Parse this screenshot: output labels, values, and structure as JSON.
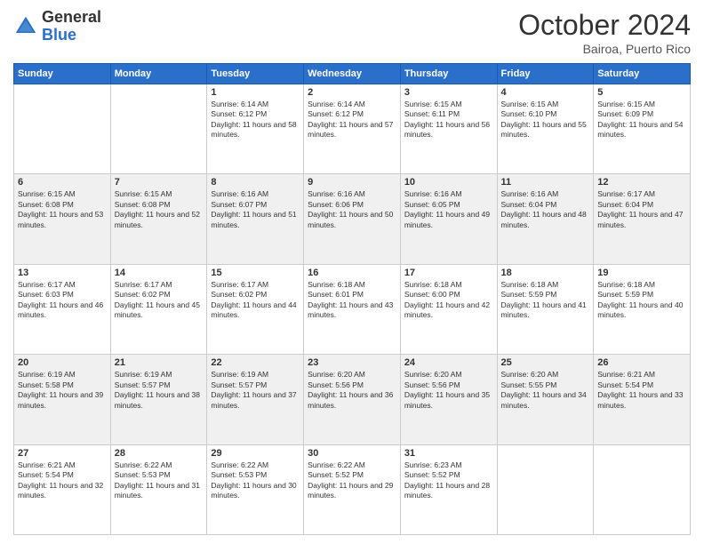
{
  "header": {
    "logo_general": "General",
    "logo_blue": "Blue",
    "month_title": "October 2024",
    "subtitle": "Bairoa, Puerto Rico"
  },
  "days_of_week": [
    "Sunday",
    "Monday",
    "Tuesday",
    "Wednesday",
    "Thursday",
    "Friday",
    "Saturday"
  ],
  "weeks": [
    [
      {
        "day": "",
        "sunrise": "",
        "sunset": "",
        "daylight": "",
        "empty": true
      },
      {
        "day": "",
        "sunrise": "",
        "sunset": "",
        "daylight": "",
        "empty": true
      },
      {
        "day": "1",
        "sunrise": "Sunrise: 6:14 AM",
        "sunset": "Sunset: 6:12 PM",
        "daylight": "Daylight: 11 hours and 58 minutes."
      },
      {
        "day": "2",
        "sunrise": "Sunrise: 6:14 AM",
        "sunset": "Sunset: 6:12 PM",
        "daylight": "Daylight: 11 hours and 57 minutes."
      },
      {
        "day": "3",
        "sunrise": "Sunrise: 6:15 AM",
        "sunset": "Sunset: 6:11 PM",
        "daylight": "Daylight: 11 hours and 56 minutes."
      },
      {
        "day": "4",
        "sunrise": "Sunrise: 6:15 AM",
        "sunset": "Sunset: 6:10 PM",
        "daylight": "Daylight: 11 hours and 55 minutes."
      },
      {
        "day": "5",
        "sunrise": "Sunrise: 6:15 AM",
        "sunset": "Sunset: 6:09 PM",
        "daylight": "Daylight: 11 hours and 54 minutes."
      }
    ],
    [
      {
        "day": "6",
        "sunrise": "Sunrise: 6:15 AM",
        "sunset": "Sunset: 6:08 PM",
        "daylight": "Daylight: 11 hours and 53 minutes."
      },
      {
        "day": "7",
        "sunrise": "Sunrise: 6:15 AM",
        "sunset": "Sunset: 6:08 PM",
        "daylight": "Daylight: 11 hours and 52 minutes."
      },
      {
        "day": "8",
        "sunrise": "Sunrise: 6:16 AM",
        "sunset": "Sunset: 6:07 PM",
        "daylight": "Daylight: 11 hours and 51 minutes."
      },
      {
        "day": "9",
        "sunrise": "Sunrise: 6:16 AM",
        "sunset": "Sunset: 6:06 PM",
        "daylight": "Daylight: 11 hours and 50 minutes."
      },
      {
        "day": "10",
        "sunrise": "Sunrise: 6:16 AM",
        "sunset": "Sunset: 6:05 PM",
        "daylight": "Daylight: 11 hours and 49 minutes."
      },
      {
        "day": "11",
        "sunrise": "Sunrise: 6:16 AM",
        "sunset": "Sunset: 6:04 PM",
        "daylight": "Daylight: 11 hours and 48 minutes."
      },
      {
        "day": "12",
        "sunrise": "Sunrise: 6:17 AM",
        "sunset": "Sunset: 6:04 PM",
        "daylight": "Daylight: 11 hours and 47 minutes."
      }
    ],
    [
      {
        "day": "13",
        "sunrise": "Sunrise: 6:17 AM",
        "sunset": "Sunset: 6:03 PM",
        "daylight": "Daylight: 11 hours and 46 minutes."
      },
      {
        "day": "14",
        "sunrise": "Sunrise: 6:17 AM",
        "sunset": "Sunset: 6:02 PM",
        "daylight": "Daylight: 11 hours and 45 minutes."
      },
      {
        "day": "15",
        "sunrise": "Sunrise: 6:17 AM",
        "sunset": "Sunset: 6:02 PM",
        "daylight": "Daylight: 11 hours and 44 minutes."
      },
      {
        "day": "16",
        "sunrise": "Sunrise: 6:18 AM",
        "sunset": "Sunset: 6:01 PM",
        "daylight": "Daylight: 11 hours and 43 minutes."
      },
      {
        "day": "17",
        "sunrise": "Sunrise: 6:18 AM",
        "sunset": "Sunset: 6:00 PM",
        "daylight": "Daylight: 11 hours and 42 minutes."
      },
      {
        "day": "18",
        "sunrise": "Sunrise: 6:18 AM",
        "sunset": "Sunset: 5:59 PM",
        "daylight": "Daylight: 11 hours and 41 minutes."
      },
      {
        "day": "19",
        "sunrise": "Sunrise: 6:18 AM",
        "sunset": "Sunset: 5:59 PM",
        "daylight": "Daylight: 11 hours and 40 minutes."
      }
    ],
    [
      {
        "day": "20",
        "sunrise": "Sunrise: 6:19 AM",
        "sunset": "Sunset: 5:58 PM",
        "daylight": "Daylight: 11 hours and 39 minutes."
      },
      {
        "day": "21",
        "sunrise": "Sunrise: 6:19 AM",
        "sunset": "Sunset: 5:57 PM",
        "daylight": "Daylight: 11 hours and 38 minutes."
      },
      {
        "day": "22",
        "sunrise": "Sunrise: 6:19 AM",
        "sunset": "Sunset: 5:57 PM",
        "daylight": "Daylight: 11 hours and 37 minutes."
      },
      {
        "day": "23",
        "sunrise": "Sunrise: 6:20 AM",
        "sunset": "Sunset: 5:56 PM",
        "daylight": "Daylight: 11 hours and 36 minutes."
      },
      {
        "day": "24",
        "sunrise": "Sunrise: 6:20 AM",
        "sunset": "Sunset: 5:56 PM",
        "daylight": "Daylight: 11 hours and 35 minutes."
      },
      {
        "day": "25",
        "sunrise": "Sunrise: 6:20 AM",
        "sunset": "Sunset: 5:55 PM",
        "daylight": "Daylight: 11 hours and 34 minutes."
      },
      {
        "day": "26",
        "sunrise": "Sunrise: 6:21 AM",
        "sunset": "Sunset: 5:54 PM",
        "daylight": "Daylight: 11 hours and 33 minutes."
      }
    ],
    [
      {
        "day": "27",
        "sunrise": "Sunrise: 6:21 AM",
        "sunset": "Sunset: 5:54 PM",
        "daylight": "Daylight: 11 hours and 32 minutes."
      },
      {
        "day": "28",
        "sunrise": "Sunrise: 6:22 AM",
        "sunset": "Sunset: 5:53 PM",
        "daylight": "Daylight: 11 hours and 31 minutes."
      },
      {
        "day": "29",
        "sunrise": "Sunrise: 6:22 AM",
        "sunset": "Sunset: 5:53 PM",
        "daylight": "Daylight: 11 hours and 30 minutes."
      },
      {
        "day": "30",
        "sunrise": "Sunrise: 6:22 AM",
        "sunset": "Sunset: 5:52 PM",
        "daylight": "Daylight: 11 hours and 29 minutes."
      },
      {
        "day": "31",
        "sunrise": "Sunrise: 6:23 AM",
        "sunset": "Sunset: 5:52 PM",
        "daylight": "Daylight: 11 hours and 28 minutes."
      },
      {
        "day": "",
        "sunrise": "",
        "sunset": "",
        "daylight": "",
        "empty": true
      },
      {
        "day": "",
        "sunrise": "",
        "sunset": "",
        "daylight": "",
        "empty": true
      }
    ]
  ]
}
